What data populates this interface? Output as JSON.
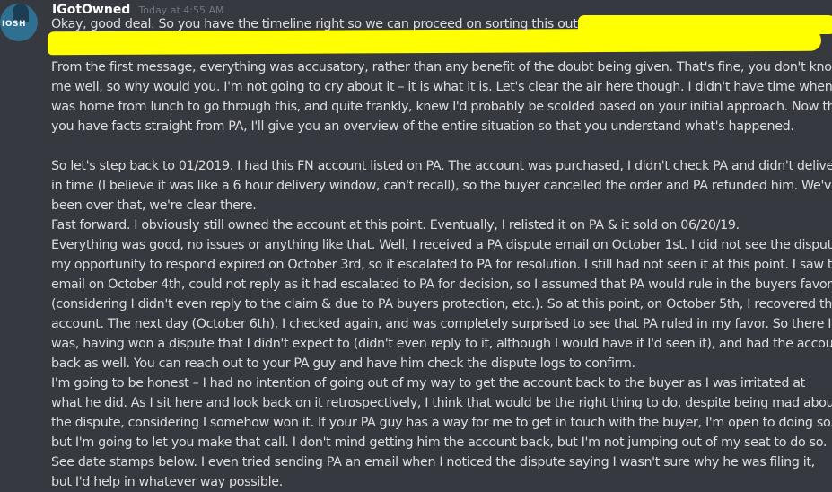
{
  "message": {
    "username": "IGotOwned",
    "timestamp": "Today at 4:55 AM",
    "avatar_text": "IOSH",
    "lines": [
      "Okay, good deal. So you have the timeline right so we can proceed on sorting this out.",
      "",
      "From the first message, everything was accusatory, rather than any benefit of the doubt being given. That's fine, you don't know",
      "me well, so why would you. I'm not going to cry about it – it is what it is. Let's clear the air here though. I didn't have time when I",
      "was home from lunch to go through this, and quite frankly, knew I'd probably be scolded based on your initial approach. Now that",
      "you have facts straight from PA, I'll give you an overview of the entire situation so that you understand what's happened.",
      "",
      "So let's step back to 01/2019. I had this FN account listed on PA. The account was purchased, I didn't check PA and didn't deliver",
      "in time (I believe it was like a 6 hour delivery window, can't recall), so the buyer cancelled the order and PA refunded him. We've",
      "been over that, we're clear there.",
      "Fast forward. I obviously still owned the account at this point. Eventually, I relisted it on PA & it sold on 06/20/19.",
      "Everything was good, no issues or anything like that. Well, I received a PA dispute email on October 1st. I did not see the dispute &",
      "my opportunity to respond expired on October 3rd, so it escalated to PA for resolution. I still had not seen it at this point. I saw the",
      "email on October 4th, could not reply as it had escalated to PA for decision, so I assumed that PA would rule in the buyers favor",
      "(considering I didn't even reply to the claim & due to PA buyers protection, etc.). So at this point, on October 5th, I recovered the",
      "account. The next day (October 6th), I checked again, and was completely surprised to see that PA ruled in my favor. So there I",
      "was, having won a dispute that I didn't expect to (didn't even reply to it, although I would have if I'd seen it), and had the account",
      "back as well. You can reach out to your PA guy and have him check the dispute logs to confirm.",
      "I'm going to be honest – I had no intention of going out of my way to get the account back to the buyer as I was irritated at",
      "what he did. As I sit here and look back on it retrospectively, I think that would be the right thing to do, despite being mad about",
      "the dispute, considering I somehow won it. If your PA guy has a way for me to get in touch with the buyer, I'm open to doing so..",
      "but I'm going to let you make that call. I don't mind getting him the account back, but I'm not jumping out of my seat to do so.",
      "See date stamps below. I even tried sending PA an email when I noticed the dispute saying I wasn't sure why he was filing it,",
      "but I'd help in whatever way possible."
    ]
  },
  "colors": {
    "background": "#36393f",
    "username": "#ffffff",
    "timestamp": "#72767d",
    "text": "#dcddde",
    "highlight": "#ffff00"
  }
}
